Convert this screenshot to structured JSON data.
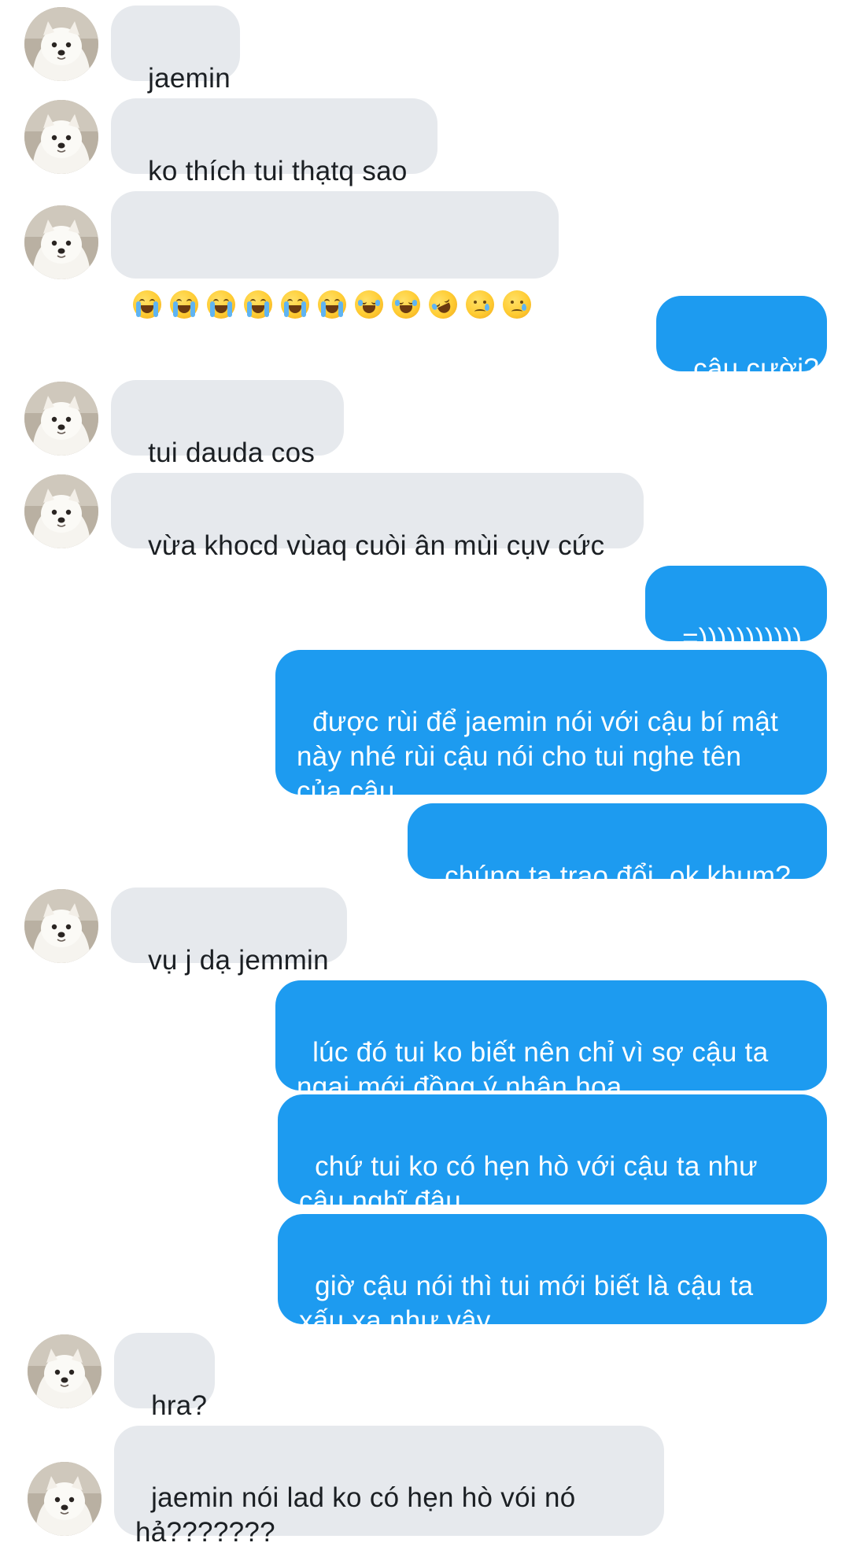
{
  "messages": [
    {
      "side": "in",
      "text": "jaemin"
    },
    {
      "side": "in",
      "text": "ko thích tui thạtq sao"
    },
    {
      "side": "in",
      "emoji": [
        "loudly-crying",
        "loudly-crying",
        "loudly-crying",
        "loudly-crying",
        "loudly-crying",
        "loudly-crying",
        "tears-of-joy",
        "tears-of-joy",
        "rolling-on-floor-laughing",
        "face-holding-back-tears",
        "face-holding-back-tears"
      ]
    },
    {
      "side": "out",
      "text": "cậu cười?"
    },
    {
      "side": "in",
      "text": "tui dauda cos"
    },
    {
      "side": "in",
      "text": "vừa khocd vùaq cuòi ân mùi cụv cức"
    },
    {
      "side": "out",
      "text": "=)))))))))))"
    },
    {
      "side": "out",
      "text": "được rùi để jaemin nói với cậu bí mật\nnày nhé rùi cậu nói cho tui nghe tên\ncủa cậu"
    },
    {
      "side": "out",
      "text": "chúng ta trao đổi, ok khum?"
    },
    {
      "side": "in",
      "text": "vụ j dạ jemmin"
    },
    {
      "side": "out",
      "text": "lúc đó tui ko biết nên chỉ vì sợ cậu ta\nngại mới đồng ý nhận hoa"
    },
    {
      "side": "out",
      "text": "chứ tui ko có hẹn hò với cậu ta như\ncậu nghĩ đâu"
    },
    {
      "side": "out",
      "text": "giờ cậu nói thì tui mới biết là cậu ta\nxấu xa như vậy"
    },
    {
      "side": "in",
      "text": "hra?"
    },
    {
      "side": "in",
      "text": "jaemin nói lad ko có hẹn hò vói nó\nhả???????"
    }
  ],
  "colors": {
    "incoming_bubble": "#e6e9ed",
    "outgoing_bubble": "#1d9bf0",
    "incoming_text": "#1b1f23",
    "outgoing_text": "#ffffff"
  }
}
